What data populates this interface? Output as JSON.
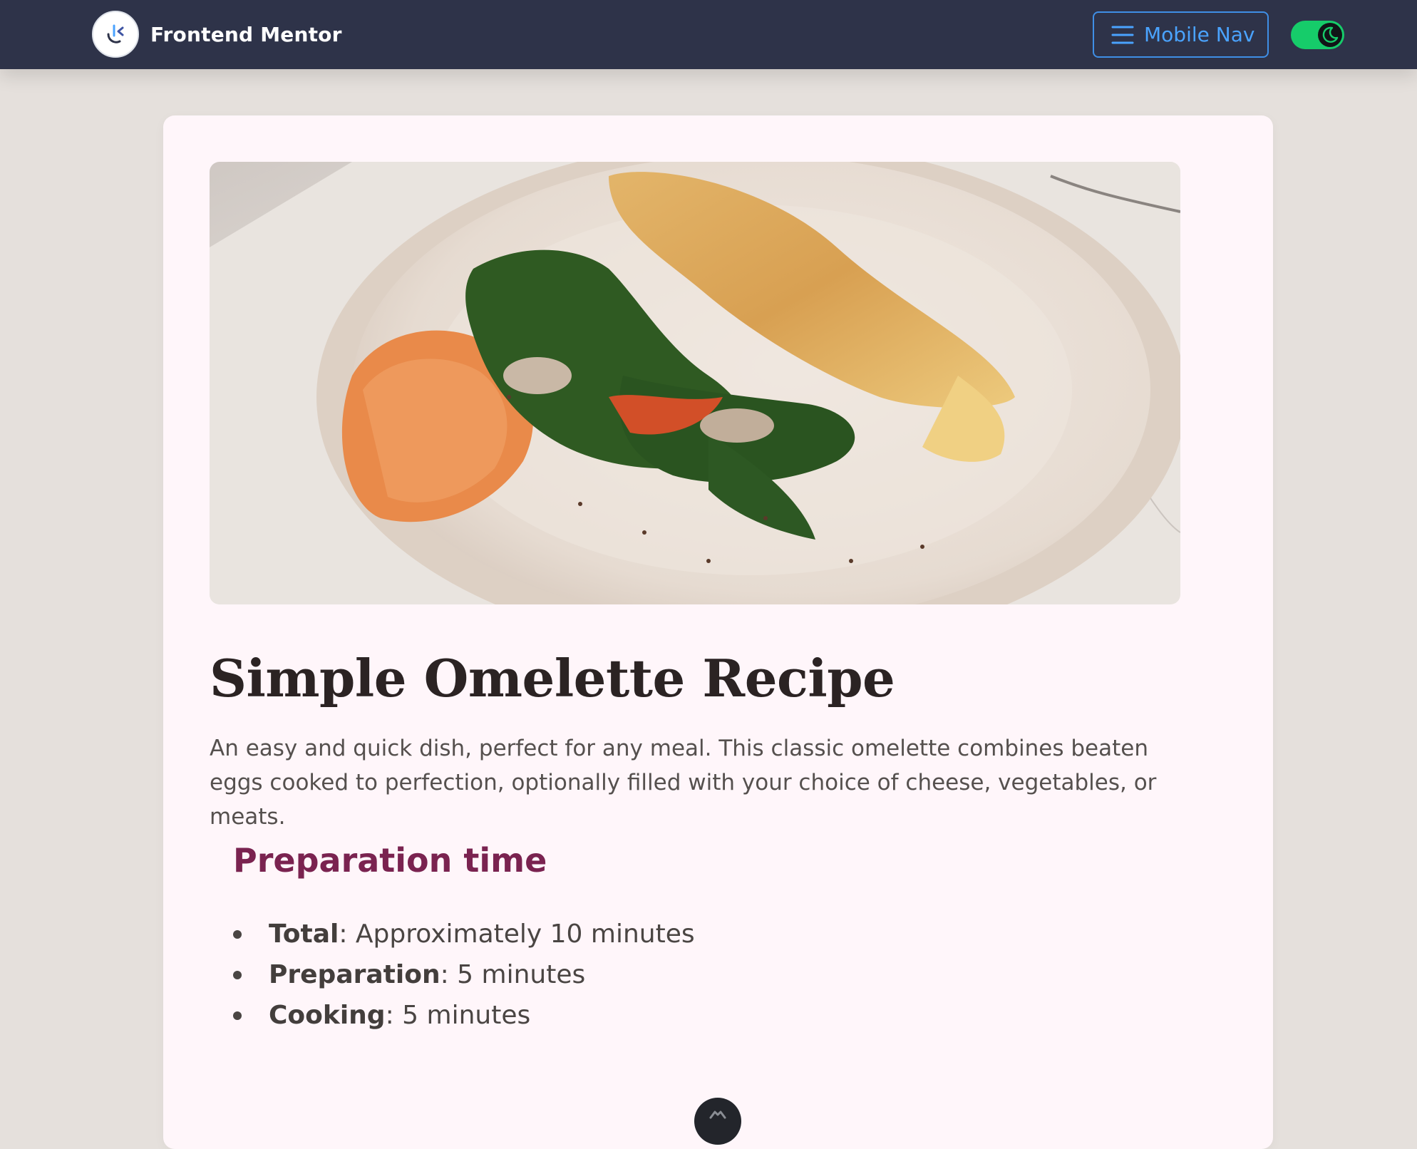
{
  "navbar": {
    "brand_name": "Frontend Mentor",
    "logo_icon": "frontend-mentor-logo-icon",
    "mobile_nav_label": "Mobile Nav",
    "menu_icon": "hamburger-menu-icon",
    "theme_toggle": {
      "state": "on",
      "icon": "moon-icon"
    },
    "colors": {
      "background": "#2e3349",
      "accent": "#4aa3ff",
      "toggle": "#16cc6a"
    }
  },
  "recipe": {
    "image_alt": "Omelette with spinach and dill on a plate",
    "title": "Simple Omelette Recipe",
    "description": "An easy and quick dish, perfect for any meal. This classic omelette combines beaten eggs cooked to perfection, optionally filled with your choice of cheese, vegetables, or meats.",
    "preparation": {
      "heading": "Preparation time",
      "items": [
        {
          "label": "Total",
          "value": ": Approximately 10 minutes"
        },
        {
          "label": "Preparation",
          "value": ": 5 minutes"
        },
        {
          "label": "Cooking",
          "value": ": 5 minutes"
        }
      ]
    },
    "colors": {
      "card": "#fff6fa",
      "heading": "#7a2350",
      "title": "#2b2323"
    }
  },
  "scroll_button": {
    "icon": "chevron-up-icon"
  }
}
